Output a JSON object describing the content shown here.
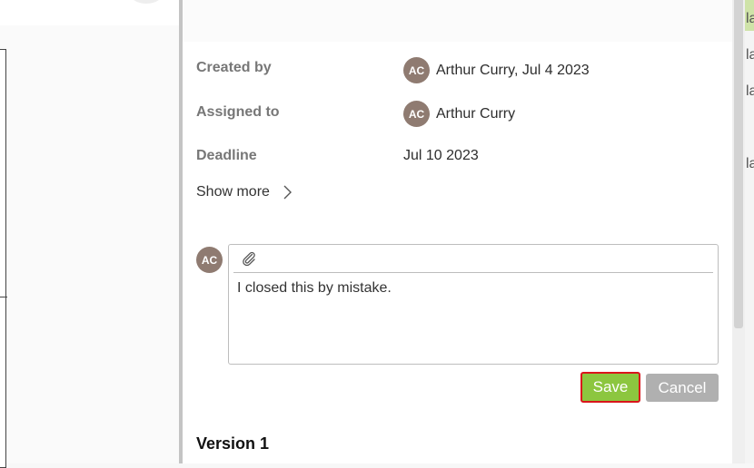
{
  "details": {
    "created_by_label": "Created by",
    "created_by_initials": "AC",
    "created_by_value": "Arthur Curry, Jul 4 2023",
    "assigned_to_label": "Assigned to",
    "assigned_to_initials": "AC",
    "assigned_to_value": "Arthur Curry",
    "deadline_label": "Deadline",
    "deadline_value": "Jul 10 2023",
    "show_more_label": "Show more"
  },
  "comment": {
    "avatar_initials": "AC",
    "text": "I closed this by mistake.",
    "attach_icon": "paperclip-icon"
  },
  "actions": {
    "save_label": "Save",
    "cancel_label": "Cancel"
  },
  "version": {
    "heading": "Version 1"
  },
  "background_right": {
    "fragments": [
      "la",
      "la",
      "la",
      "la"
    ]
  },
  "colors": {
    "save_button": "#8cc63f",
    "save_button_focus_border": "#d9141b",
    "cancel_button": "#b0b0b0",
    "avatar": "#8f7b71"
  }
}
